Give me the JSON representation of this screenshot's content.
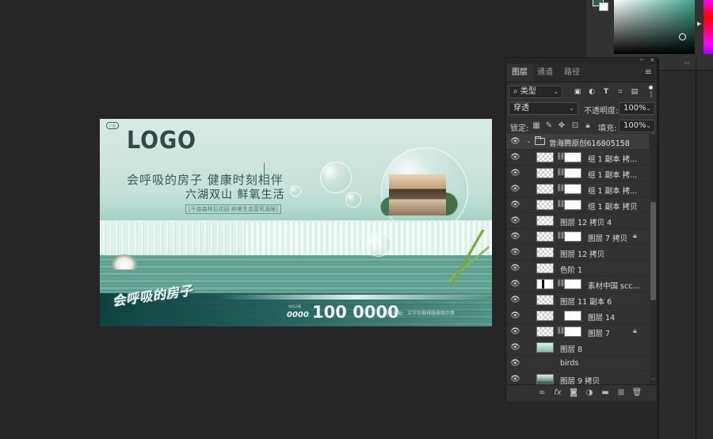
{
  "color_picker": {
    "foreground_color": "#2e5f50",
    "background_color": "#ffffff",
    "hue_color": "#3ea58a"
  },
  "artwork": {
    "corner_tag": "广告",
    "logo": "LOGO",
    "headline": "会呼吸的房子 健康时刻相伴",
    "subheadline": "六湖双山 鲜氧生活",
    "tagline": "[千亩森林后花园  醉美生态富氧湖居]",
    "calligraphy": "会呼吸的房子",
    "tel_label": "电话示意",
    "tel_prefix": "0000",
    "tel_number": "100 0000",
    "address": "项目地址：文字仅做排版美观示意"
  },
  "layers_panel": {
    "tabs": [
      "图层",
      "通道",
      "路径"
    ],
    "active_tab": "图层",
    "filter_kind": "类型",
    "blend_mode": "穿透",
    "opacity_label": "不透明度:",
    "opacity_value": "100%",
    "lock_label": "锁定:",
    "fill_label": "填充:",
    "fill_value": "100%",
    "layers": [
      {
        "name": "曾海腾原创616805158",
        "type": "group"
      },
      {
        "name": "组 1 副本 拷...",
        "thumb": "checker",
        "mask": true
      },
      {
        "name": "组 1 副本 拷...",
        "thumb": "checker",
        "mask": true
      },
      {
        "name": "组 1 副本 拷...",
        "thumb": "checker",
        "mask": true
      },
      {
        "name": "组 1 副本 拷贝",
        "thumb": "checker",
        "mask": true
      },
      {
        "name": "图层 12 拷贝 4",
        "thumb": "checker",
        "mask": false
      },
      {
        "name": "图层 7 拷贝",
        "thumb": "checker",
        "mask": true,
        "locked": true
      },
      {
        "name": "图层 12 拷贝",
        "thumb": "checker",
        "mask": false
      },
      {
        "name": "色阶 1",
        "thumb": "checker",
        "mask": false
      },
      {
        "name": "素材中国 scc...",
        "thumb": "dark",
        "mask": true
      },
      {
        "name": "图层 11 副本 6",
        "thumb": "checker",
        "mask": false
      },
      {
        "name": "图层 14",
        "thumb": "checker",
        "mask": true
      },
      {
        "name": "图层 7",
        "thumb": "checker",
        "mask": true,
        "locked": true
      },
      {
        "name": "图层 8",
        "thumb": "teal",
        "mask": false
      },
      {
        "name": "birds",
        "thumb": "none",
        "mask": false
      },
      {
        "name": "图层 9 拷贝",
        "thumb": "mixed",
        "mask": false
      }
    ],
    "bottom_icons": [
      "link-icon",
      "fx-icon",
      "mask-icon",
      "adjustment-icon",
      "folder-icon",
      "new-layer-icon",
      "trash-icon"
    ]
  }
}
